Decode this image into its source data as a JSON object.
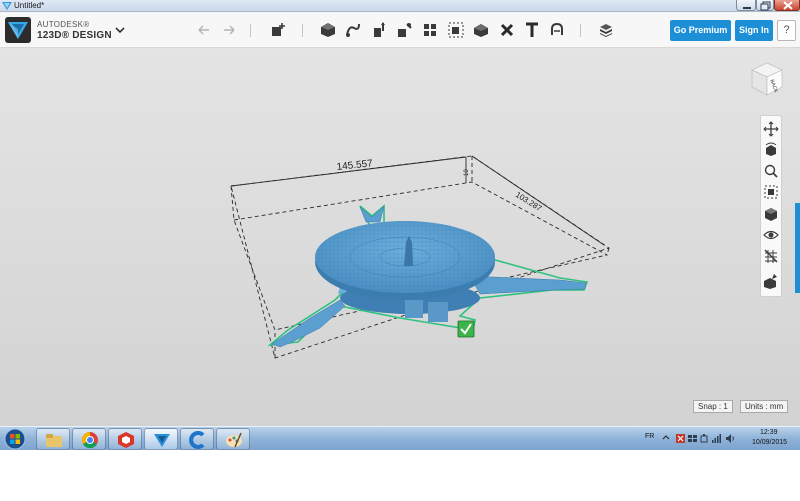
{
  "window": {
    "title": "Untitled*"
  },
  "toolbar": {
    "logo_line1": "AUTODESK®",
    "logo_line2": "123D® DESIGN",
    "tools": [
      "undo-icon",
      "redo-icon",
      "add-object-icon",
      "primitives-icon",
      "sketch-icon",
      "construct-icon",
      "modify-icon",
      "pattern-icon",
      "group-icon",
      "combine-icon",
      "measure-icon",
      "text-icon",
      "snap-icon",
      "material-icon"
    ],
    "go_premium_label": "Go Premium",
    "sign_in_label": "Sign In",
    "help_label": "?"
  },
  "viewport": {
    "viewcube_face": "BACK",
    "dimension_length": "145.557",
    "dimension_width": "103.287",
    "dimension_height": "10",
    "nav_tools": [
      "pan-icon",
      "orbit-icon",
      "zoom-icon",
      "fit-icon",
      "view-mode-icon",
      "visibility-icon",
      "hide-grid-icon",
      "material-view-icon"
    ],
    "snap_label": "Snap : 1",
    "units_label": "Units : mm"
  },
  "colors": {
    "accent": "#1d8fd6",
    "model": "#5b9fd0",
    "selection": "#2ec27e"
  },
  "taskbar": {
    "apps": [
      "start-orb-icon",
      "file-explorer-icon",
      "chrome-icon",
      "sketchup-icon",
      "123d-design-icon",
      "ccleaner-icon",
      "paint-icon"
    ],
    "language": "FR",
    "time": "12:39",
    "date": "10/09/2015"
  }
}
